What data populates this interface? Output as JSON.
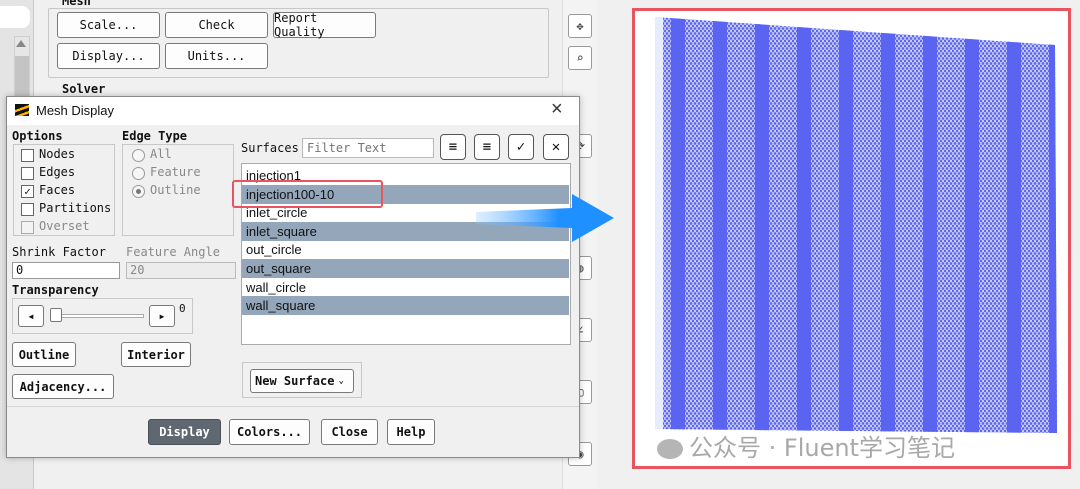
{
  "background": {
    "mesh_group": "Mesh",
    "scale_button": "Scale...",
    "check_button": "Check",
    "report_quality_button": "Report Quality",
    "display_button": "Display...",
    "units_button": "Units...",
    "solver_group": "Solver"
  },
  "dialog": {
    "title": "Mesh Display",
    "close_glyph": "×",
    "options_header": "Options",
    "options": [
      {
        "label": "Nodes",
        "checked": false,
        "enabled": true
      },
      {
        "label": "Edges",
        "checked": false,
        "enabled": true
      },
      {
        "label": "Faces",
        "checked": true,
        "enabled": true
      },
      {
        "label": "Partitions",
        "checked": false,
        "enabled": true
      },
      {
        "label": "Overset",
        "checked": false,
        "enabled": false
      }
    ],
    "edge_type_header": "Edge Type",
    "edge_types": [
      {
        "label": "All",
        "selected": false
      },
      {
        "label": "Feature",
        "selected": false
      },
      {
        "label": "Outline",
        "selected": true
      }
    ],
    "shrink_factor_label": "Shrink Factor",
    "shrink_factor_value": "0",
    "feature_angle_label": "Feature Angle",
    "feature_angle_value": "20",
    "transparency_label": "Transparency",
    "transparency_value": "0",
    "outline_button": "Outline",
    "interior_button": "Interior",
    "adjacency_button": "Adjacency...",
    "surfaces_label": "Surfaces",
    "filter_placeholder": "Filter Text",
    "surfaces": [
      {
        "name": "injection1",
        "selected": false
      },
      {
        "name": "injection100-10",
        "selected": true
      },
      {
        "name": "inlet_circle",
        "selected": false
      },
      {
        "name": "inlet_square",
        "selected": true
      },
      {
        "name": "out_circle",
        "selected": false
      },
      {
        "name": "out_square",
        "selected": true
      },
      {
        "name": "wall_circle",
        "selected": false
      },
      {
        "name": "wall_square",
        "selected": true
      }
    ],
    "new_surface_button": "New Surface",
    "footer": {
      "display": "Display",
      "colors": "Colors...",
      "close": "Close",
      "help": "Help"
    }
  },
  "annotation": {
    "highlight_color": "#e8545f",
    "arrow_color": "#1e90ff"
  },
  "render": {
    "stripe_color": "#5a64f0",
    "mesh_color": "#ffffff"
  },
  "watermark": "公众号 · Fluent学习笔记"
}
